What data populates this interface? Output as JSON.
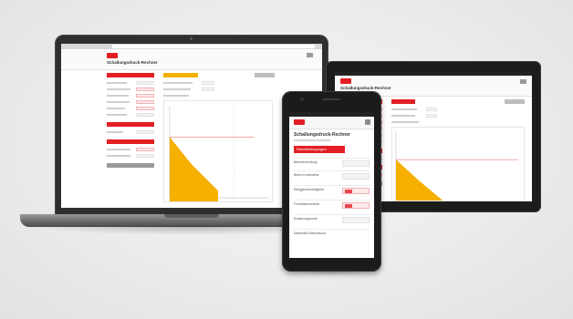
{
  "scene": {
    "description_colors": {
      "accent": "#e31e24",
      "chart_fill": "#f5b000",
      "device_dark": "#1c1c1c"
    }
  },
  "phone": {
    "title": "Schallungsdruck-Rechner",
    "red_button_label": "Randbedingungen",
    "rows": [
      {
        "label": "Betonierrichtung",
        "red": false
      },
      {
        "label": "Beton-Konsistenz",
        "red": false
      },
      {
        "label": "Steiggeschwindigkeit",
        "red": true
      },
      {
        "label": "Frischbetonwichte",
        "red": true
      },
      {
        "label": "Erstarrungsende",
        "red": false
      },
      {
        "label": "Maximaler Betondruck",
        "red": false
      }
    ]
  }
}
